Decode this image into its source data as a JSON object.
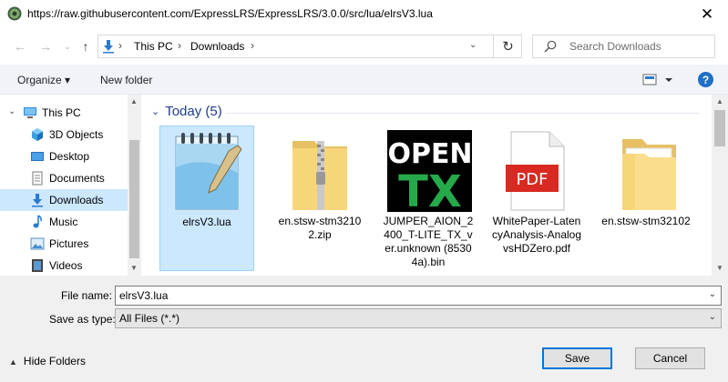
{
  "window": {
    "title": "https://raw.githubusercontent.com/ExpressLRS/ExpressLRS/3.0.0/src/lua/elrsV3.lua",
    "close_label": "✕"
  },
  "nav": {
    "breadcrumbs": [
      "This PC",
      "Downloads"
    ],
    "search_placeholder": "Search Downloads"
  },
  "toolbar": {
    "organize_label": "Organize ▾",
    "new_folder_label": "New folder",
    "help_label": "?"
  },
  "sidebar": {
    "items": [
      {
        "label": "This PC",
        "icon": "computer-icon"
      },
      {
        "label": "3D Objects",
        "icon": "cube-icon"
      },
      {
        "label": "Desktop",
        "icon": "desktop-icon"
      },
      {
        "label": "Documents",
        "icon": "document-icon"
      },
      {
        "label": "Downloads",
        "icon": "download-icon",
        "selected": true
      },
      {
        "label": "Music",
        "icon": "music-icon"
      },
      {
        "label": "Pictures",
        "icon": "picture-icon"
      },
      {
        "label": "Videos",
        "icon": "video-icon"
      }
    ]
  },
  "content": {
    "group_label": "Today (5)",
    "files": [
      {
        "name": "elrsV3.lua",
        "icon": "notepad-icon",
        "selected": true
      },
      {
        "name": "en.stsw-stm32102.zip",
        "icon": "zip-folder-icon"
      },
      {
        "name": "JUMPER_AION_2400_T-LITE_TX_ver.unknown (85304a).bin",
        "icon": "opentx-logo-icon",
        "logo_text": [
          "OPEN",
          "TX"
        ]
      },
      {
        "name": "WhitePaper-LatencyAnalysis-AnalogvsHDZero.pdf",
        "icon": "pdf-icon",
        "logo_text": [
          "PDF"
        ]
      },
      {
        "name": "en.stsw-stm32102",
        "icon": "folder-icon"
      }
    ]
  },
  "form": {
    "file_name_label": "File name:",
    "file_name_value": "elrsV3.lua",
    "save_as_type_label": "Save as type:",
    "save_as_type_value": "All Files (*.*)",
    "hide_folders_label": "Hide Folders",
    "save_label": "Save",
    "cancel_label": "Cancel"
  },
  "colors": {
    "selection": "#cce8ff",
    "accent": "#0078d7",
    "group_heading": "#1e3d8f"
  }
}
